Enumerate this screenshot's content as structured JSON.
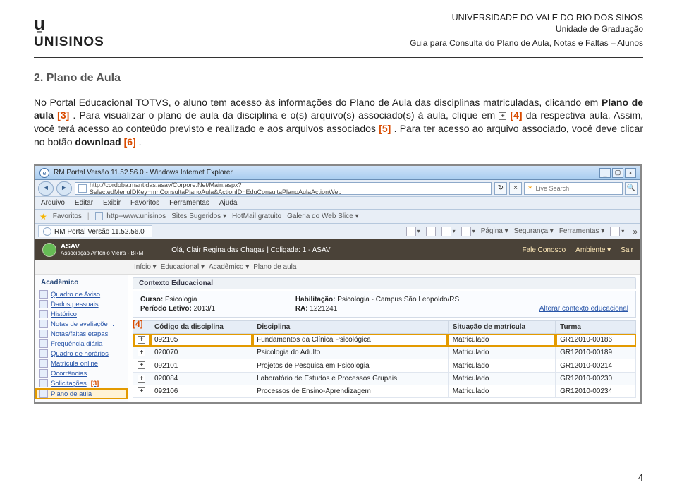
{
  "header": {
    "uni": "UNIVERSIDADE DO VALE DO RIO DOS SINOS",
    "unit": "Unidade de Graduação",
    "guide": "Guia para Consulta do Plano de Aula, Notas e Faltas – Alunos",
    "logo_word": "UNISINOS"
  },
  "section": {
    "title": "2. Plano de Aula",
    "p1a": "No Portal Educacional TOTVS, o aluno tem acesso às informações do Plano de Aula das disciplinas matriculadas, clicando em ",
    "p1b": "Plano de aula",
    "ref3": "[3]",
    "p1c": ". Para visualizar o plano de aula da disciplina e o(s) arquivo(s) associado(s) à aula, clique em ",
    "ref4": "[4]",
    "p1d": " da respectiva aula. Assim, você terá acesso ao conteúdo previsto e realizado e aos arquivos associados ",
    "ref5": "[5]",
    "p1e": ". Para ter acesso ao arquivo associado, você deve clicar no botão ",
    "p1f": "download",
    "ref6": "[6]",
    "p1g": "."
  },
  "ie": {
    "title": "RM Portal Versão 11.52.56.0 - Windows Internet Explorer",
    "url": "http://cordoba.mantidas.asav/Corpore.Net/Main.aspx?SelectedMenuIDKey=mnConsultaPlanoAula&ActionID=EduConsultaPlanoAulaActionWeb",
    "search_placeholder": "Live Search",
    "menus": [
      "Arquivo",
      "Editar",
      "Exibir",
      "Favoritos",
      "Ferramentas",
      "Ajuda"
    ],
    "fav_label": "Favoritos",
    "fav_site": "http--www.unisinos",
    "fav_chips": [
      "Sites Sugeridos ▾",
      "HotMail gratuito",
      "Galeria do Web Slice ▾"
    ],
    "tab_label": "RM Portal Versão 11.52.56.0",
    "tools": {
      "pagina": "Página ▾",
      "seguranca": "Segurança ▾",
      "ferramentas": "Ferramentas ▾"
    }
  },
  "portal": {
    "brand_top": "ASAV",
    "brand_sub": "Associação Antônio Vieira - BRM",
    "user": "Olá, Clair Regina das Chagas  |  Coligada: 1 - ASAV",
    "right": [
      "Fale Conosco",
      "Ambiente ▾",
      "Sair"
    ],
    "crumbs": [
      "Início ▾",
      "Educacional ▾",
      "Acadêmico ▾",
      "Plano de aula"
    ],
    "sidebar_title": "Acadêmico",
    "sidebar": [
      "Quadro de Aviso",
      "Dados pessoais",
      "Histórico",
      "Notas de avaliaçõe…",
      "Notas/faltas etapas",
      "Frequência diária",
      "Quadro de horários",
      "Matrícula online",
      "Ocorrências",
      "Solicitações",
      "Plano de aula"
    ],
    "ctx_header": "Contexto Educacional",
    "ctx": {
      "curso_lbl": "Curso:",
      "curso": " Psicologia",
      "periodo_lbl": "Período Letivo:",
      "periodo": " 2013/1",
      "hab_lbl": "Habilitação:",
      "hab": " Psicologia - Campus São Leopoldo/RS",
      "ra_lbl": "RA:",
      "ra": " 1221241",
      "alterar": "Alterar contexto educacional"
    },
    "table": {
      "cols": [
        "",
        "Código da disciplina",
        "Disciplina",
        "Situação de matrícula",
        "Turma"
      ],
      "rows": [
        [
          "092105",
          "Fundamentos da Clínica Psicológica",
          "Matriculado",
          "GR12010-00186"
        ],
        [
          "020070",
          "Psicologia do Adulto",
          "Matriculado",
          "GR12010-00189"
        ],
        [
          "092101",
          "Projetos de Pesquisa em Psicologia",
          "Matriculado",
          "GR12010-00214"
        ],
        [
          "020084",
          "Laboratório de Estudos e Processos Grupais",
          "Matriculado",
          "GR12010-00230"
        ],
        [
          "092106",
          "Processos de Ensino-Aprendizagem",
          "Matriculado",
          "GR12010-00234"
        ]
      ]
    }
  },
  "refs": {
    "tag4": "[4]",
    "tag3": "[3]"
  },
  "page_number": "4"
}
